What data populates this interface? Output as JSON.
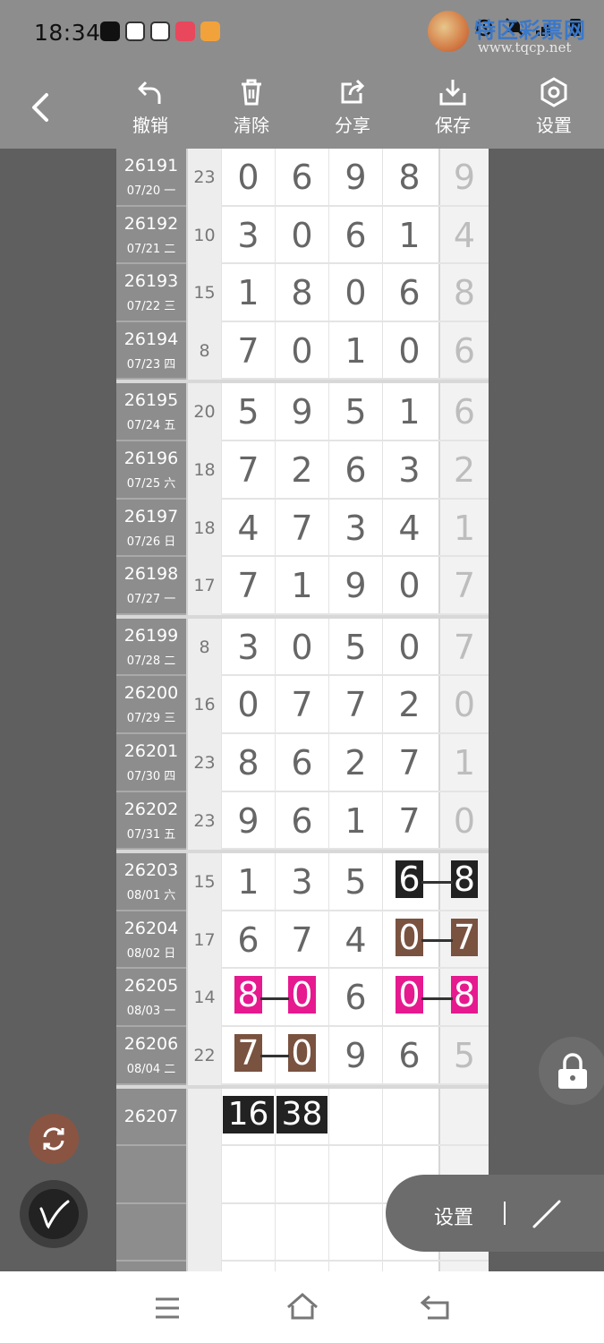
{
  "status": {
    "time": "18:34"
  },
  "watermark": {
    "title": "特区彩票网",
    "url": "www.tqcp.net"
  },
  "toolbar": {
    "undo_label": "撤销",
    "clear_label": "清除",
    "share_label": "分享",
    "save_label": "保存",
    "settings_label": "设置"
  },
  "rows": [
    {
      "issue": "26191",
      "date": "07/20 一",
      "sum": "23",
      "digits": [
        "0",
        "6",
        "9",
        "8",
        "9"
      ]
    },
    {
      "issue": "26192",
      "date": "07/21 二",
      "sum": "10",
      "digits": [
        "3",
        "0",
        "6",
        "1",
        "4"
      ]
    },
    {
      "issue": "26193",
      "date": "07/22 三",
      "sum": "15",
      "digits": [
        "1",
        "8",
        "0",
        "6",
        "8"
      ]
    },
    {
      "issue": "26194",
      "date": "07/23 四",
      "sum": "8",
      "digits": [
        "7",
        "0",
        "1",
        "0",
        "6"
      ]
    },
    {
      "issue": "26195",
      "date": "07/24 五",
      "sum": "20",
      "digits": [
        "5",
        "9",
        "5",
        "1",
        "6"
      ]
    },
    {
      "issue": "26196",
      "date": "07/25 六",
      "sum": "18",
      "digits": [
        "7",
        "2",
        "6",
        "3",
        "2"
      ]
    },
    {
      "issue": "26197",
      "date": "07/26 日",
      "sum": "18",
      "digits": [
        "4",
        "7",
        "3",
        "4",
        "1"
      ]
    },
    {
      "issue": "26198",
      "date": "07/27 一",
      "sum": "17",
      "digits": [
        "7",
        "1",
        "9",
        "0",
        "7"
      ]
    },
    {
      "issue": "26199",
      "date": "07/28 二",
      "sum": "8",
      "digits": [
        "3",
        "0",
        "5",
        "0",
        "7"
      ]
    },
    {
      "issue": "26200",
      "date": "07/29 三",
      "sum": "16",
      "digits": [
        "0",
        "7",
        "7",
        "2",
        "0"
      ]
    },
    {
      "issue": "26201",
      "date": "07/30 四",
      "sum": "23",
      "digits": [
        "8",
        "6",
        "2",
        "7",
        "1"
      ]
    },
    {
      "issue": "26202",
      "date": "07/31 五",
      "sum": "23",
      "digits": [
        "9",
        "6",
        "1",
        "7",
        "0"
      ]
    },
    {
      "issue": "26203",
      "date": "08/01 六",
      "sum": "15",
      "digits": [
        "1",
        "3",
        "5",
        "6",
        "8"
      ]
    },
    {
      "issue": "26204",
      "date": "08/02 日",
      "sum": "17",
      "digits": [
        "6",
        "7",
        "4",
        "0",
        "7"
      ]
    },
    {
      "issue": "26205",
      "date": "08/03 一",
      "sum": "14",
      "digits": [
        "8",
        "0",
        "6",
        "0",
        "8"
      ]
    },
    {
      "issue": "26206",
      "date": "08/04 二",
      "sum": "22",
      "digits": [
        "7",
        "0",
        "9",
        "6",
        "5"
      ]
    },
    {
      "issue": "26207",
      "date": "",
      "sum": "",
      "digits": [
        "16",
        "38",
        "",
        "",
        ""
      ]
    }
  ],
  "marks": {
    "black": "#222222",
    "brown": "#7a5240",
    "pink": "#e6198f"
  },
  "pill": {
    "label": "设置"
  }
}
